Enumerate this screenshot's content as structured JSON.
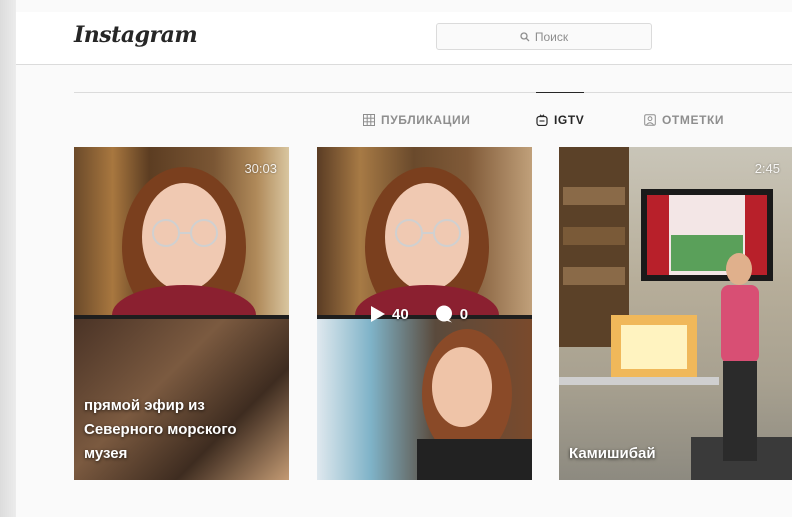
{
  "header": {
    "logo": "Instagram",
    "search_placeholder": "Поиск"
  },
  "tabs": [
    {
      "label": "ПУБЛИКАЦИИ",
      "icon": "grid-icon",
      "active": false
    },
    {
      "label": "IGTV",
      "icon": "igtv-icon",
      "active": true
    },
    {
      "label": "ОТМЕТКИ",
      "icon": "tagged-icon",
      "active": false
    }
  ],
  "videos": [
    {
      "duration": "30:03",
      "caption": "прямой эфир из Северного морского музея"
    },
    {
      "plays": "40",
      "comments": "0"
    },
    {
      "duration": "2:45",
      "caption": "Камишибай"
    }
  ],
  "colors": {
    "text": "#262626",
    "muted": "#8e8e8e",
    "border": "#dbdbdb",
    "background": "#fafafa"
  }
}
